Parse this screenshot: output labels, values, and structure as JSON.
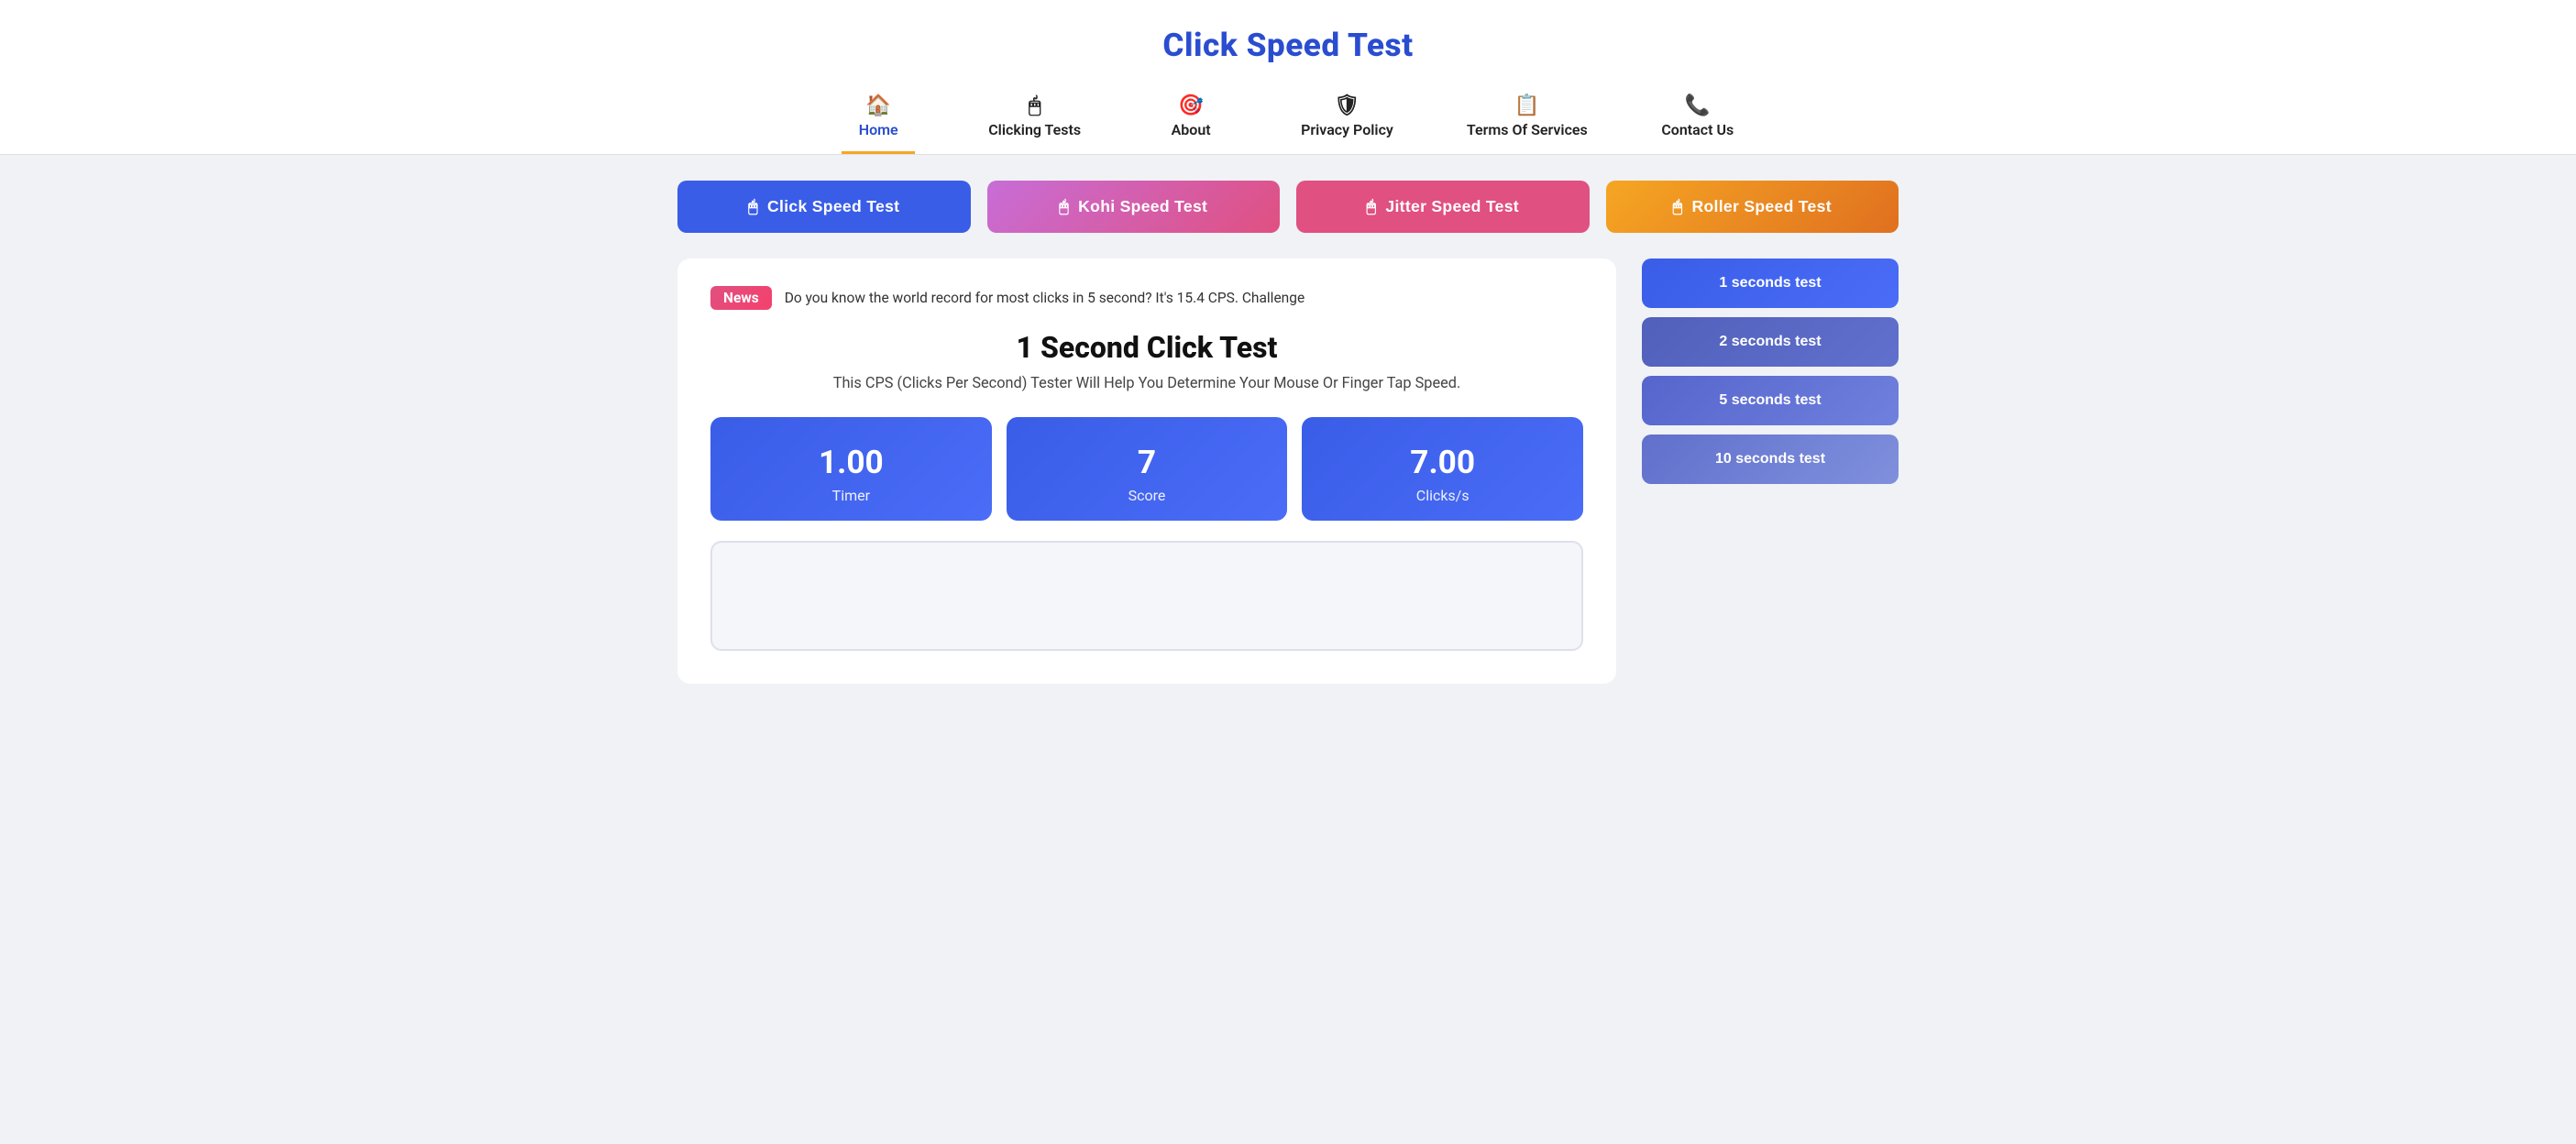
{
  "header": {
    "site_title": "Click Speed Test",
    "nav": [
      {
        "id": "home",
        "label": "Home",
        "icon": "🏠",
        "active": true
      },
      {
        "id": "clicking-tests",
        "label": "Clicking Tests",
        "icon": "🖱",
        "active": false
      },
      {
        "id": "about",
        "label": "About",
        "icon": "🎯",
        "active": false
      },
      {
        "id": "privacy-policy",
        "label": "Privacy Policy",
        "icon": "🛡",
        "active": false
      },
      {
        "id": "terms-of-services",
        "label": "Terms Of Services",
        "icon": "📋",
        "active": false
      },
      {
        "id": "contact-us",
        "label": "Contact Us",
        "icon": "📞",
        "active": false
      }
    ]
  },
  "test_buttons": [
    {
      "id": "click-speed-test",
      "label": "Click Speed Test",
      "class": "test-btn-click"
    },
    {
      "id": "kohi-speed-test",
      "label": "Kohi Speed Test",
      "class": "test-btn-kohi"
    },
    {
      "id": "jitter-speed-test",
      "label": "Jitter Speed Test",
      "class": "test-btn-jitter"
    },
    {
      "id": "roller-speed-test",
      "label": "Roller Speed Test",
      "class": "test-btn-roller"
    }
  ],
  "news": {
    "badge": "News",
    "text": "Do you know the world record for most clicks in 5 second? It's 15.4 CPS. Challenge"
  },
  "main": {
    "title": "1 Second Click Test",
    "subtitle": "This CPS (Clicks Per Second) Tester Will Help You Determine Your Mouse Or Finger Tap Speed.",
    "stats": [
      {
        "id": "timer",
        "value": "1.00",
        "label": "Timer"
      },
      {
        "id": "score",
        "value": "7",
        "label": "Score"
      },
      {
        "id": "clicks_per_second",
        "value": "7.00",
        "label": "Clicks/s"
      }
    ]
  },
  "sidebar_buttons": [
    {
      "id": "1-seconds-test",
      "label": "1 seconds test"
    },
    {
      "id": "2-seconds-test",
      "label": "2 seconds test"
    },
    {
      "id": "5-seconds-test",
      "label": "5 seconds test"
    },
    {
      "id": "10-seconds-test",
      "label": "10 seconds test"
    },
    {
      "id": "more-seconds-test",
      "label": "..."
    }
  ],
  "icons": {
    "mouse": "🖱",
    "home": "🏠",
    "target": "🎯",
    "shield": "🛡",
    "document": "📋",
    "phone": "📞"
  }
}
